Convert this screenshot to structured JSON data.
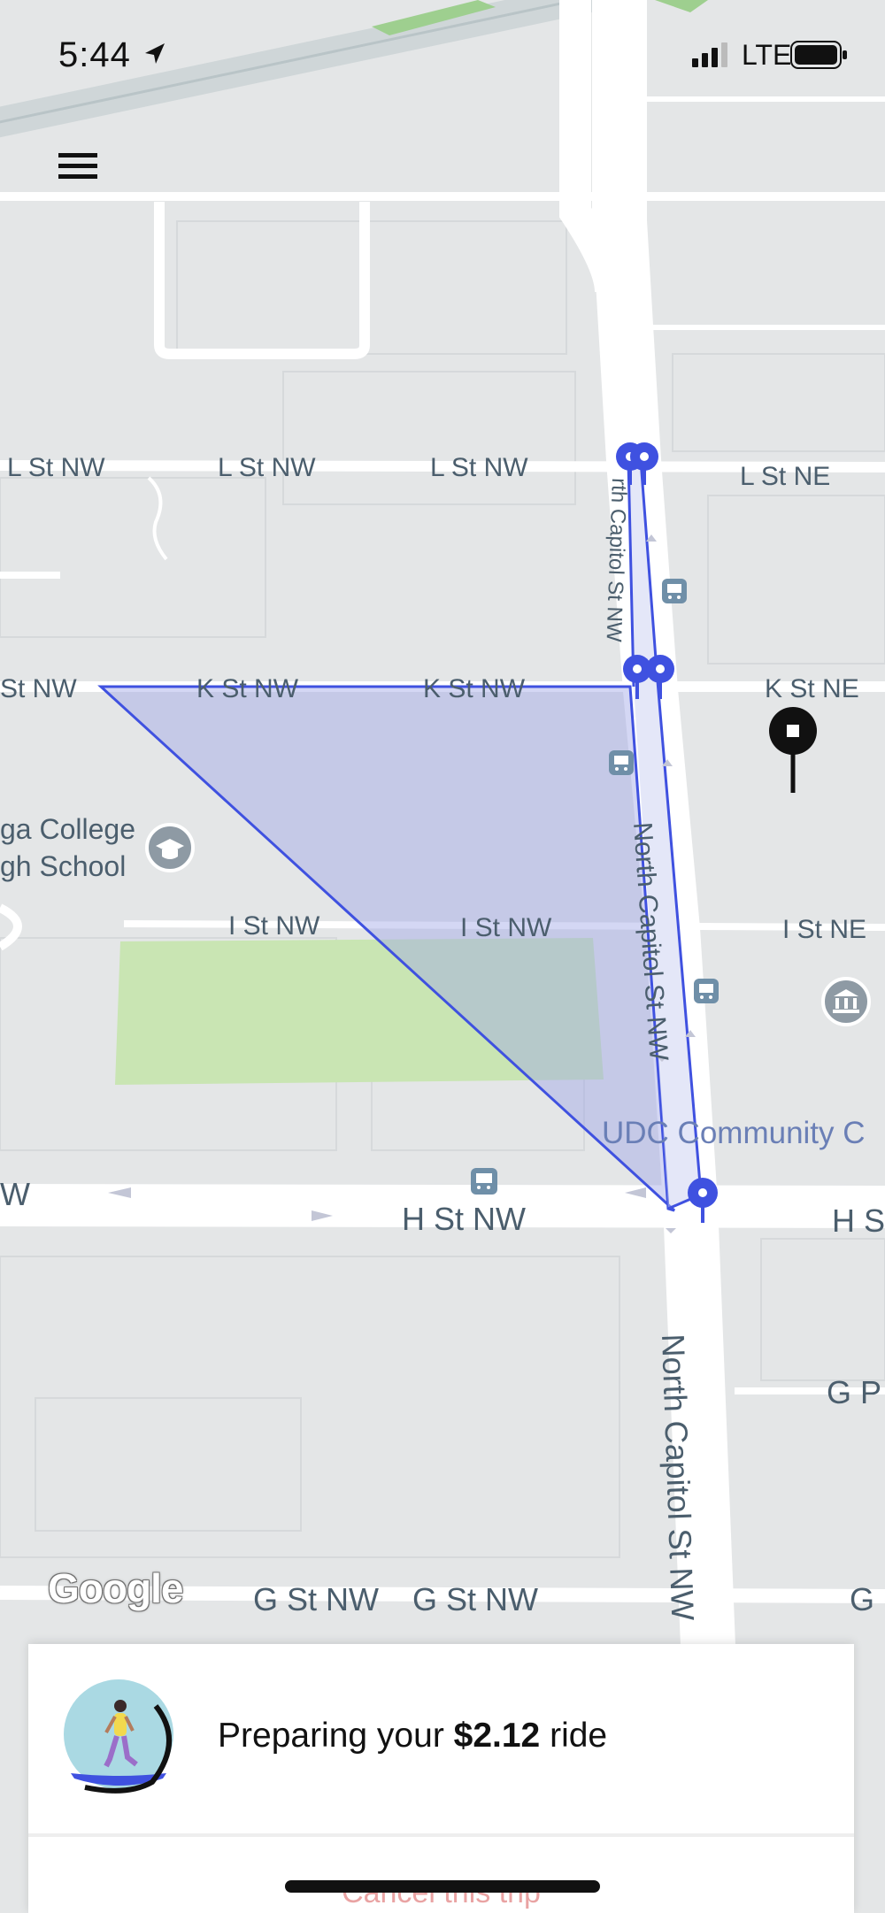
{
  "status_bar": {
    "time": "5:44",
    "network": "LTE"
  },
  "map": {
    "streets": {
      "l_st_nw_1": "L St NW",
      "l_st_nw_2": "L St NW",
      "l_st_nw_3": "L St NW",
      "l_st_ne": "L St NE",
      "k_st_nw_1": "St NW",
      "k_st_nw_2": "K St NW",
      "k_st_nw_3": "K St NW",
      "k_st_ne": "K St NE",
      "i_st_nw_1": "I St NW",
      "i_st_nw_2": "I St NW",
      "i_st_ne": "I St NE",
      "h_st_nw_left": "W",
      "h_st_nw": "H St NW",
      "h_st_right": "H S",
      "g_st_nw_1": "G St NW",
      "g_st_nw_2": "G St NW",
      "g_right": "G",
      "g_pl": "G P",
      "north_capitol_upper": "rth Capitol St NW",
      "north_capitol_mid": "North Capitol St NW",
      "north_capitol_lower": "North Capitol St NW"
    },
    "places": {
      "school_line1": "ga College",
      "school_line2": "gh School",
      "udc": "UDC Community C"
    },
    "attribution": "Google",
    "colors": {
      "route": "#3f51e0",
      "route_fill": "#9fa6e6",
      "park": "#c9e5b3",
      "road": "#ffffff",
      "block": "#e4e6e7",
      "poi": "#6f8fa8"
    }
  },
  "trip_sheet": {
    "text_prefix": "Preparing your ",
    "price": "$2.12",
    "text_suffix": " ride",
    "cancel": "Cancel this trip"
  }
}
